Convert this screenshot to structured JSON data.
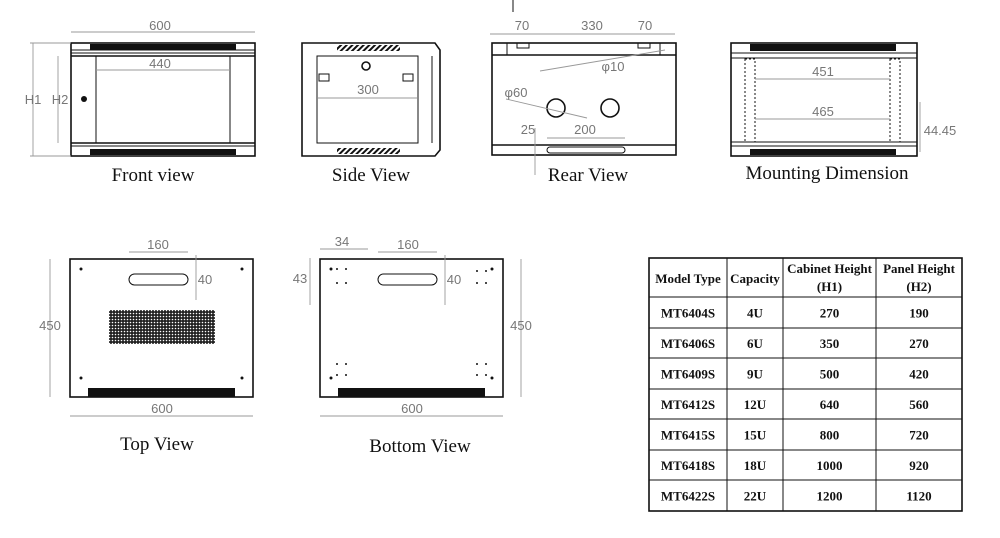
{
  "views": {
    "front": {
      "label": "Front view",
      "width": "600",
      "inner_width": "440",
      "h1": "H1",
      "h2": "H2"
    },
    "side": {
      "label": "Side View",
      "depth": "300"
    },
    "rear": {
      "label": "Rear View",
      "left_offset": "70",
      "middle": "330",
      "right_offset": "70",
      "hole_small": "φ10",
      "hole_large": "φ60",
      "slot_offset": "25",
      "slot_width": "200"
    },
    "mounting": {
      "label": "Mounting Dimension",
      "inner": "451",
      "rail": "465",
      "unit_height": "44.45"
    },
    "top": {
      "label": "Top View",
      "slot_width": "160",
      "slot_height": "40",
      "depth": "450",
      "width": "600"
    },
    "bottom": {
      "label": "Bottom View",
      "hole_spacing_x": "34",
      "slot_width": "160",
      "hole_spacing_y": "43",
      "slot_height": "40",
      "depth": "450",
      "width": "600"
    }
  },
  "table": {
    "headers": [
      "Model Type",
      "Capacity",
      "Cabinet Height",
      "Panel Height"
    ],
    "subheaders": [
      "",
      "",
      "(H1)",
      "(H2)"
    ],
    "rows": [
      [
        "MT6404S",
        "4U",
        "270",
        "190"
      ],
      [
        "MT6406S",
        "6U",
        "350",
        "270"
      ],
      [
        "MT6409S",
        "9U",
        "500",
        "420"
      ],
      [
        "MT6412S",
        "12U",
        "640",
        "560"
      ],
      [
        "MT6415S",
        "15U",
        "800",
        "720"
      ],
      [
        "MT6418S",
        "18U",
        "1000",
        "920"
      ],
      [
        "MT6422S",
        "22U",
        "1200",
        "1120"
      ]
    ]
  }
}
